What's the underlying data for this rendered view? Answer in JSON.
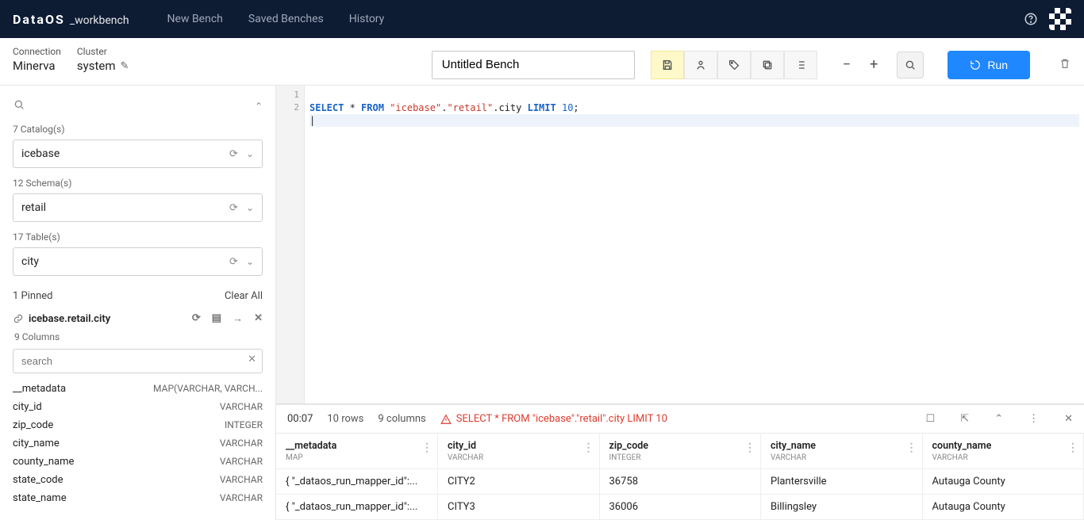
{
  "app": {
    "brand": "DataOS",
    "sub": "_workbench"
  },
  "nav": {
    "newBench": "New Bench",
    "savedBenches": "Saved Benches",
    "history": "History"
  },
  "header": {
    "connectionLabel": "Connection",
    "connectionValue": "Minerva",
    "clusterLabel": "Cluster",
    "clusterValue": "system",
    "benchName": "Untitled Bench",
    "runLabel": "Run"
  },
  "sidebar": {
    "catalog": {
      "caption": "7 Catalog(s)",
      "value": "icebase"
    },
    "schema": {
      "caption": "12 Schema(s)",
      "value": "retail"
    },
    "table": {
      "caption": "17 Table(s)",
      "value": "city"
    },
    "pinnedLabel": "1 Pinned",
    "clearAll": "Clear All",
    "pinned": {
      "name": "icebase.retail.city",
      "columnsLabel": "9 Columns",
      "searchPlaceholder": "search",
      "columns": [
        {
          "name": "__metadata",
          "type": "MAP(VARCHAR, VARCH..."
        },
        {
          "name": "city_id",
          "type": "VARCHAR"
        },
        {
          "name": "zip_code",
          "type": "INTEGER"
        },
        {
          "name": "city_name",
          "type": "VARCHAR"
        },
        {
          "name": "county_name",
          "type": "VARCHAR"
        },
        {
          "name": "state_code",
          "type": "VARCHAR"
        },
        {
          "name": "state_name",
          "type": "VARCHAR"
        }
      ]
    }
  },
  "editor": {
    "lines": [
      "1",
      "2"
    ],
    "tokens": {
      "select": "SELECT",
      "star": " * ",
      "from": "FROM",
      "sp": " ",
      "s1": "\"icebase\"",
      "dot": ".",
      "s2": "\"retail\"",
      "s3": ".city ",
      "limit": "LIMIT",
      "num": "10",
      "semi": ";"
    }
  },
  "results": {
    "elapsed": "00:07",
    "rows": "10 rows",
    "cols": "9 columns",
    "queryEcho": "SELECT * FROM \"icebase\".\"retail\".city LIMIT 10",
    "headers": [
      {
        "name": "__metadata",
        "type": "MAP"
      },
      {
        "name": "city_id",
        "type": "VARCHAR"
      },
      {
        "name": "zip_code",
        "type": "INTEGER"
      },
      {
        "name": "city_name",
        "type": "VARCHAR"
      },
      {
        "name": "county_name",
        "type": "VARCHAR"
      }
    ],
    "data": [
      {
        "meta": "{ \"_dataos_run_mapper_id\":...",
        "city_id": "CITY2",
        "zip_code": "36758",
        "city_name": "Plantersville",
        "county_name": "Autauga County"
      },
      {
        "meta": "{ \"_dataos_run_mapper_id\":...",
        "city_id": "CITY3",
        "zip_code": "36006",
        "city_name": "Billingsley",
        "county_name": "Autauga County"
      }
    ]
  }
}
